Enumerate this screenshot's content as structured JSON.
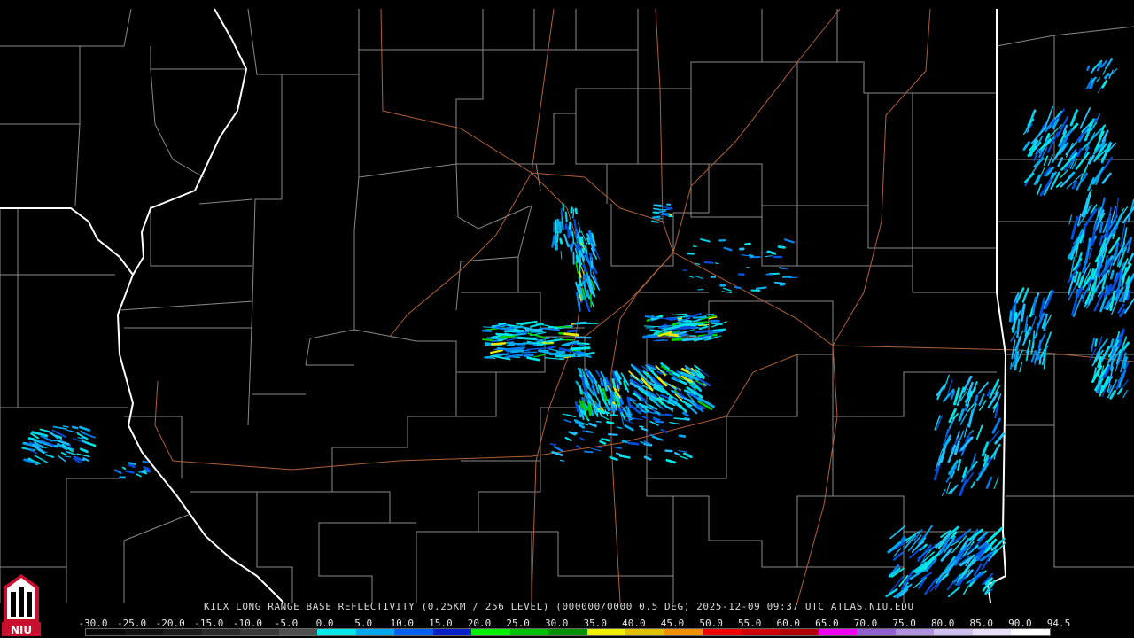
{
  "product_title": "KILX LONG RANGE BASE REFLECTIVITY (0.25KM / 256 LEVEL) (000000/0000 0.5 DEG) 2025-12-09 09:37 UTC  ATLAS.NIU.EDU",
  "logo_text": "NIU",
  "scale_labels": [
    "-30.0",
    "-25.0",
    "-20.0",
    "-15.0",
    "-10.0",
    "-5.0",
    "0.0",
    "5.0",
    "10.0",
    "15.0",
    "20.0",
    "25.0",
    "30.0",
    "35.0",
    "40.0",
    "45.0",
    "50.0",
    "55.0",
    "60.0",
    "65.0",
    "70.0",
    "75.0",
    "80.0",
    "85.0",
    "90.0",
    "94.5"
  ],
  "scale_colors": [
    "#060606",
    "#101010",
    "#1c1c1c",
    "#2a2a2a",
    "#3a3a3a",
    "#4e4e4e",
    "#00e8e8",
    "#00a8f0",
    "#0060f0",
    "#0020c8",
    "#00f000",
    "#00c000",
    "#009000",
    "#f0f000",
    "#e0c000",
    "#f09000",
    "#f00000",
    "#d00000",
    "#b00000",
    "#f000f0",
    "#9060d0",
    "#b090e0",
    "#d0c0f0",
    "#e8e0f8",
    "#ffffff"
  ],
  "colors": {
    "background": "#000000",
    "county_lines": "#8a8a8a",
    "state_lines": "#ffffff",
    "highways": "#b0603a",
    "text": "#d8d8d8"
  }
}
